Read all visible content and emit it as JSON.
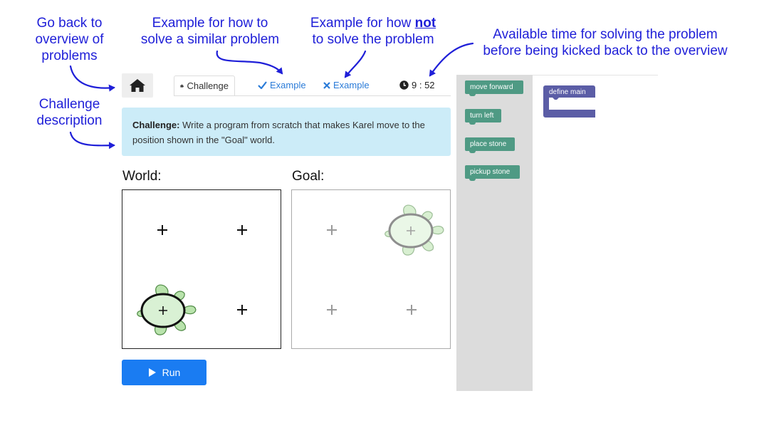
{
  "annotations": {
    "back_line1": "Go back to",
    "back_line2": "overview of",
    "back_line3": "problems",
    "example_line1": "Example for how to",
    "example_line2": "solve a similar problem",
    "nonexample_line1_prefix": "Example for how ",
    "nonexample_line1_emph": "not",
    "nonexample_line2": "to solve the problem",
    "time_line1": "Available time for solving the problem",
    "time_line2": "before being kicked back to the overview",
    "challenge_line1": "Challenge",
    "challenge_line2": "description"
  },
  "tabs": {
    "challenge": "Challenge",
    "example": "Example",
    "nonexample": "Example"
  },
  "timer": "9 : 52",
  "challenge": {
    "label": "Challenge:",
    "text": " Write a program from scratch that makes Karel move to the position shown in the \"Goal\" world."
  },
  "world_label": "World:",
  "goal_label": "Goal:",
  "run_label": "Run",
  "blocks": {
    "move_forward": "move forward",
    "turn_left": "turn left",
    "place_stone": "place stone",
    "pickup_stone": "pickup stone",
    "define_main": "define main"
  },
  "colors": {
    "annotation": "#1f1fd8",
    "example_link": "#2a7bd8",
    "challenge_bg": "#ccecf8",
    "run_button": "#1a7cf2",
    "block_green": "#4f9a84",
    "define_block": "#5b5da6",
    "toolbox": "#dcdcdc"
  },
  "icons": [
    "home-icon",
    "puzzle-icon",
    "check-icon",
    "x-icon",
    "clock-icon",
    "play-icon",
    "turtle-icon"
  ]
}
